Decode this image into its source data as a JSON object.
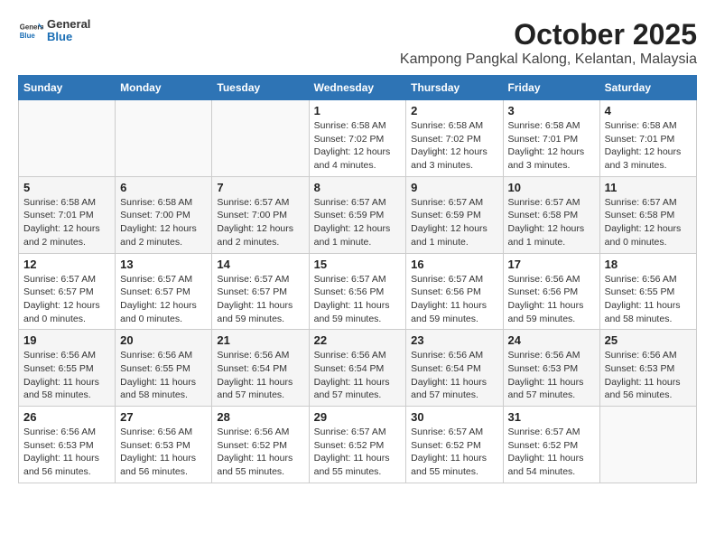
{
  "header": {
    "logo_general": "General",
    "logo_blue": "Blue",
    "month_year": "October 2025",
    "location": "Kampong Pangkal Kalong, Kelantan, Malaysia"
  },
  "weekdays": [
    "Sunday",
    "Monday",
    "Tuesday",
    "Wednesday",
    "Thursday",
    "Friday",
    "Saturday"
  ],
  "weeks": [
    [
      {
        "day": "",
        "info": ""
      },
      {
        "day": "",
        "info": ""
      },
      {
        "day": "",
        "info": ""
      },
      {
        "day": "1",
        "info": "Sunrise: 6:58 AM\nSunset: 7:02 PM\nDaylight: 12 hours\nand 4 minutes."
      },
      {
        "day": "2",
        "info": "Sunrise: 6:58 AM\nSunset: 7:02 PM\nDaylight: 12 hours\nand 3 minutes."
      },
      {
        "day": "3",
        "info": "Sunrise: 6:58 AM\nSunset: 7:01 PM\nDaylight: 12 hours\nand 3 minutes."
      },
      {
        "day": "4",
        "info": "Sunrise: 6:58 AM\nSunset: 7:01 PM\nDaylight: 12 hours\nand 3 minutes."
      }
    ],
    [
      {
        "day": "5",
        "info": "Sunrise: 6:58 AM\nSunset: 7:01 PM\nDaylight: 12 hours\nand 2 minutes."
      },
      {
        "day": "6",
        "info": "Sunrise: 6:58 AM\nSunset: 7:00 PM\nDaylight: 12 hours\nand 2 minutes."
      },
      {
        "day": "7",
        "info": "Sunrise: 6:57 AM\nSunset: 7:00 PM\nDaylight: 12 hours\nand 2 minutes."
      },
      {
        "day": "8",
        "info": "Sunrise: 6:57 AM\nSunset: 6:59 PM\nDaylight: 12 hours\nand 1 minute."
      },
      {
        "day": "9",
        "info": "Sunrise: 6:57 AM\nSunset: 6:59 PM\nDaylight: 12 hours\nand 1 minute."
      },
      {
        "day": "10",
        "info": "Sunrise: 6:57 AM\nSunset: 6:58 PM\nDaylight: 12 hours\nand 1 minute."
      },
      {
        "day": "11",
        "info": "Sunrise: 6:57 AM\nSunset: 6:58 PM\nDaylight: 12 hours\nand 0 minutes."
      }
    ],
    [
      {
        "day": "12",
        "info": "Sunrise: 6:57 AM\nSunset: 6:57 PM\nDaylight: 12 hours\nand 0 minutes."
      },
      {
        "day": "13",
        "info": "Sunrise: 6:57 AM\nSunset: 6:57 PM\nDaylight: 12 hours\nand 0 minutes."
      },
      {
        "day": "14",
        "info": "Sunrise: 6:57 AM\nSunset: 6:57 PM\nDaylight: 11 hours\nand 59 minutes."
      },
      {
        "day": "15",
        "info": "Sunrise: 6:57 AM\nSunset: 6:56 PM\nDaylight: 11 hours\nand 59 minutes."
      },
      {
        "day": "16",
        "info": "Sunrise: 6:57 AM\nSunset: 6:56 PM\nDaylight: 11 hours\nand 59 minutes."
      },
      {
        "day": "17",
        "info": "Sunrise: 6:56 AM\nSunset: 6:56 PM\nDaylight: 11 hours\nand 59 minutes."
      },
      {
        "day": "18",
        "info": "Sunrise: 6:56 AM\nSunset: 6:55 PM\nDaylight: 11 hours\nand 58 minutes."
      }
    ],
    [
      {
        "day": "19",
        "info": "Sunrise: 6:56 AM\nSunset: 6:55 PM\nDaylight: 11 hours\nand 58 minutes."
      },
      {
        "day": "20",
        "info": "Sunrise: 6:56 AM\nSunset: 6:55 PM\nDaylight: 11 hours\nand 58 minutes."
      },
      {
        "day": "21",
        "info": "Sunrise: 6:56 AM\nSunset: 6:54 PM\nDaylight: 11 hours\nand 57 minutes."
      },
      {
        "day": "22",
        "info": "Sunrise: 6:56 AM\nSunset: 6:54 PM\nDaylight: 11 hours\nand 57 minutes."
      },
      {
        "day": "23",
        "info": "Sunrise: 6:56 AM\nSunset: 6:54 PM\nDaylight: 11 hours\nand 57 minutes."
      },
      {
        "day": "24",
        "info": "Sunrise: 6:56 AM\nSunset: 6:53 PM\nDaylight: 11 hours\nand 57 minutes."
      },
      {
        "day": "25",
        "info": "Sunrise: 6:56 AM\nSunset: 6:53 PM\nDaylight: 11 hours\nand 56 minutes."
      }
    ],
    [
      {
        "day": "26",
        "info": "Sunrise: 6:56 AM\nSunset: 6:53 PM\nDaylight: 11 hours\nand 56 minutes."
      },
      {
        "day": "27",
        "info": "Sunrise: 6:56 AM\nSunset: 6:53 PM\nDaylight: 11 hours\nand 56 minutes."
      },
      {
        "day": "28",
        "info": "Sunrise: 6:56 AM\nSunset: 6:52 PM\nDaylight: 11 hours\nand 55 minutes."
      },
      {
        "day": "29",
        "info": "Sunrise: 6:57 AM\nSunset: 6:52 PM\nDaylight: 11 hours\nand 55 minutes."
      },
      {
        "day": "30",
        "info": "Sunrise: 6:57 AM\nSunset: 6:52 PM\nDaylight: 11 hours\nand 55 minutes."
      },
      {
        "day": "31",
        "info": "Sunrise: 6:57 AM\nSunset: 6:52 PM\nDaylight: 11 hours\nand 54 minutes."
      },
      {
        "day": "",
        "info": ""
      }
    ]
  ]
}
